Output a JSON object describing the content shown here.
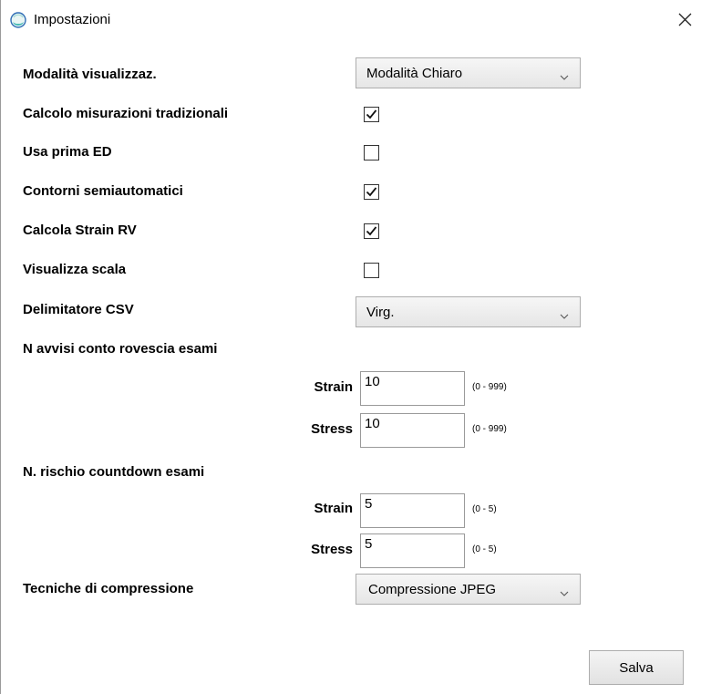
{
  "window": {
    "title": "Impostazioni"
  },
  "settings": {
    "display_mode": {
      "label": "Modalità visualizzaz.",
      "value": "Modalità Chiaro"
    },
    "traditional_measurements": {
      "label": "Calcolo misurazioni tradizionali",
      "checked": true
    },
    "use_first_ed": {
      "label": "Usa prima ED",
      "checked": false
    },
    "semiautomatic_contours": {
      "label": "Contorni semiautomatici",
      "checked": true
    },
    "calc_strain_rv": {
      "label": "Calcola Strain RV",
      "checked": true
    },
    "show_scale": {
      "label": "Visualizza scala",
      "checked": false
    },
    "csv_delimiter": {
      "label": "Delimitatore CSV",
      "value": "Virg."
    },
    "countdown_warnings": {
      "label": "N avvisi conto rovescia esami",
      "strain": {
        "label": "Strain",
        "value": "10",
        "range": "(0 - 999)"
      },
      "stress": {
        "label": "Stress",
        "value": "10",
        "range": "(0 - 999)"
      }
    },
    "risk_countdown": {
      "label": "N. rischio countdown esami",
      "strain": {
        "label": "Strain",
        "value": "5",
        "range": "(0 - 5)"
      },
      "stress": {
        "label": "Stress",
        "value": "5",
        "range": "(0 - 5)"
      }
    },
    "compression": {
      "label": "Tecniche di compressione",
      "value": "Compressione JPEG"
    }
  },
  "actions": {
    "save_label": "Salva"
  },
  "icons": {
    "app": "app-logo-icon",
    "close": "close-icon",
    "dropdown": "chevron-down-icon",
    "check": "checkmark-icon"
  },
  "colors": {
    "icon_teal": "#3bb6b0",
    "icon_blue": "#2f6db5",
    "border": "#adadad"
  }
}
